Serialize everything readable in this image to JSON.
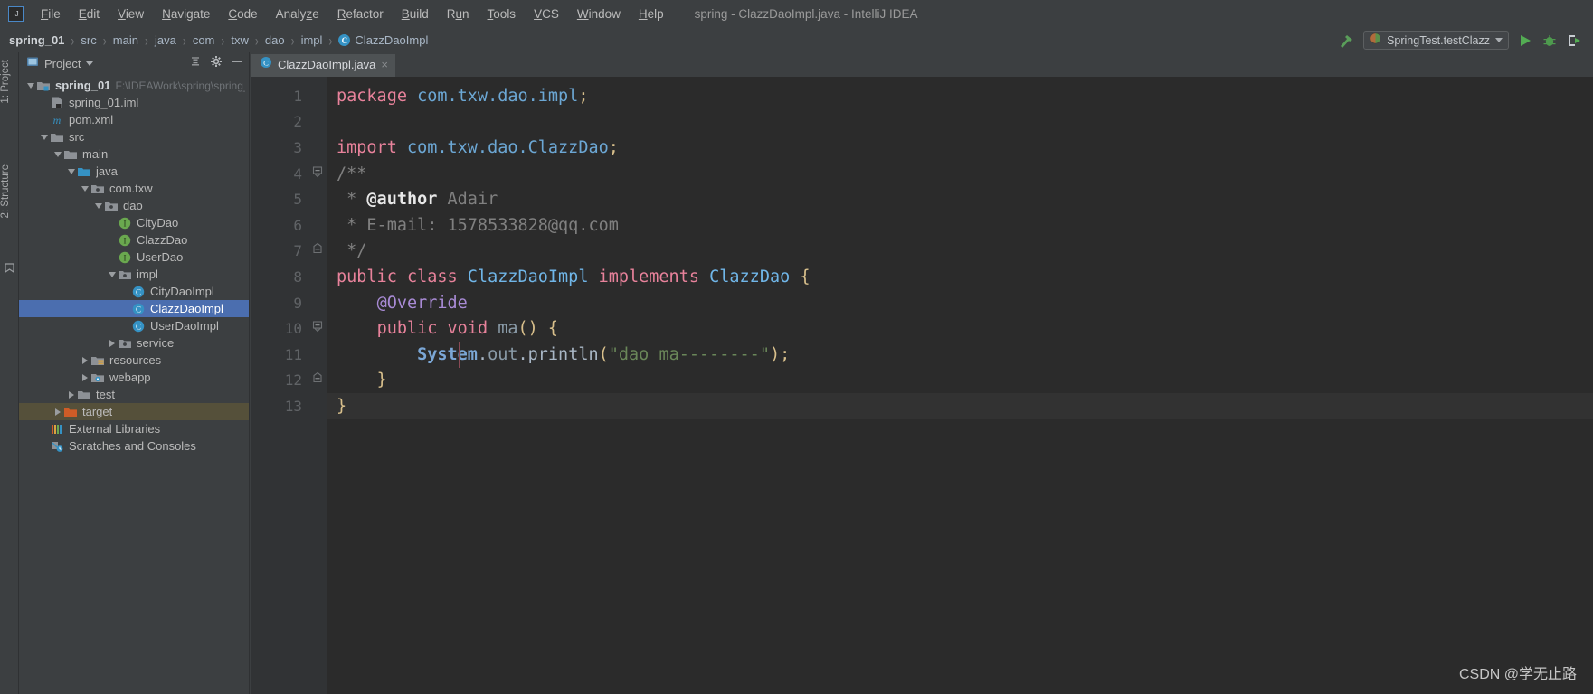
{
  "window": {
    "title": "spring - ClazzDaoImpl.java - IntelliJ IDEA",
    "logo_text": "IJ"
  },
  "menubar": {
    "items": [
      {
        "label": "File",
        "mnemonic": "F"
      },
      {
        "label": "Edit",
        "mnemonic": "E"
      },
      {
        "label": "View",
        "mnemonic": "V"
      },
      {
        "label": "Navigate",
        "mnemonic": "N"
      },
      {
        "label": "Code",
        "mnemonic": "C"
      },
      {
        "label": "Analyze",
        "mnemonic": "z"
      },
      {
        "label": "Refactor",
        "mnemonic": "R"
      },
      {
        "label": "Build",
        "mnemonic": "B"
      },
      {
        "label": "Run",
        "mnemonic": "u"
      },
      {
        "label": "Tools",
        "mnemonic": "T"
      },
      {
        "label": "VCS",
        "mnemonic": "V"
      },
      {
        "label": "Window",
        "mnemonic": "W"
      },
      {
        "label": "Help",
        "mnemonic": "H"
      }
    ]
  },
  "navbar": {
    "crumbs": [
      {
        "label": "spring_01",
        "bold": true,
        "icon": null
      },
      {
        "label": "src",
        "bold": false,
        "icon": null
      },
      {
        "label": "main",
        "bold": false,
        "icon": null
      },
      {
        "label": "java",
        "bold": false,
        "icon": null
      },
      {
        "label": "com",
        "bold": false,
        "icon": null
      },
      {
        "label": "txw",
        "bold": false,
        "icon": null
      },
      {
        "label": "dao",
        "bold": false,
        "icon": null
      },
      {
        "label": "impl",
        "bold": false,
        "icon": null
      },
      {
        "label": "ClazzDaoImpl",
        "bold": false,
        "icon": "class-icon"
      }
    ],
    "separator": "›",
    "run_config": "SpringTest.testClazz",
    "icons": [
      "hammer-icon",
      "run-icon",
      "debug-icon",
      "run-with-coverage-icon"
    ]
  },
  "left_strip": {
    "tabs": [
      {
        "label": "1: Project"
      },
      {
        "label": "2: Structure"
      }
    ],
    "bottom_icon": "favorites-icon"
  },
  "project_panel": {
    "title": "Project",
    "icons": [
      "project-view-icon",
      "collapse-all-icon",
      "settings-gear-icon",
      "hide-icon"
    ],
    "tree": [
      {
        "indent": 0,
        "twisty": "down",
        "icon": "module-icon",
        "label": "spring_01",
        "bold": true,
        "path": "F:\\IDEAWork\\spring\\spring_",
        "state": "normal"
      },
      {
        "indent": 1,
        "twisty": "none",
        "icon": "iml-icon",
        "label": "spring_01.iml",
        "bold": false,
        "path": "",
        "state": "normal"
      },
      {
        "indent": 1,
        "twisty": "none",
        "icon": "maven-icon",
        "label": "pom.xml",
        "bold": false,
        "path": "",
        "state": "normal"
      },
      {
        "indent": 1,
        "twisty": "down",
        "icon": "folder-icon",
        "label": "src",
        "bold": false,
        "path": "",
        "state": "normal"
      },
      {
        "indent": 2,
        "twisty": "down",
        "icon": "folder-icon",
        "label": "main",
        "bold": false,
        "path": "",
        "state": "normal"
      },
      {
        "indent": 3,
        "twisty": "down",
        "icon": "source-root-icon",
        "label": "java",
        "bold": false,
        "path": "",
        "state": "normal"
      },
      {
        "indent": 4,
        "twisty": "down",
        "icon": "package-icon",
        "label": "com.txw",
        "bold": false,
        "path": "",
        "state": "normal"
      },
      {
        "indent": 5,
        "twisty": "down",
        "icon": "package-icon",
        "label": "dao",
        "bold": false,
        "path": "",
        "state": "normal"
      },
      {
        "indent": 6,
        "twisty": "none",
        "icon": "interface-icon",
        "label": "CityDao",
        "bold": false,
        "path": "",
        "state": "normal"
      },
      {
        "indent": 6,
        "twisty": "none",
        "icon": "interface-icon",
        "label": "ClazzDao",
        "bold": false,
        "path": "",
        "state": "normal"
      },
      {
        "indent": 6,
        "twisty": "none",
        "icon": "interface-icon",
        "label": "UserDao",
        "bold": false,
        "path": "",
        "state": "normal"
      },
      {
        "indent": 6,
        "twisty": "down",
        "icon": "package-icon",
        "label": "impl",
        "bold": false,
        "path": "",
        "state": "normal"
      },
      {
        "indent": 7,
        "twisty": "none",
        "icon": "class-icon",
        "label": "CityDaoImpl",
        "bold": false,
        "path": "",
        "state": "normal"
      },
      {
        "indent": 7,
        "twisty": "none",
        "icon": "class-icon",
        "label": "ClazzDaoImpl",
        "bold": false,
        "path": "",
        "state": "selected"
      },
      {
        "indent": 7,
        "twisty": "none",
        "icon": "class-icon",
        "label": "UserDaoImpl",
        "bold": false,
        "path": "",
        "state": "normal"
      },
      {
        "indent": 6,
        "twisty": "right",
        "icon": "package-icon",
        "label": "service",
        "bold": false,
        "path": "",
        "state": "normal"
      },
      {
        "indent": 4,
        "twisty": "right",
        "icon": "resources-root-icon",
        "label": "resources",
        "bold": false,
        "path": "",
        "state": "normal"
      },
      {
        "indent": 4,
        "twisty": "right",
        "icon": "webapp-icon",
        "label": "webapp",
        "bold": false,
        "path": "",
        "state": "normal"
      },
      {
        "indent": 3,
        "twisty": "right",
        "icon": "folder-icon",
        "label": "test",
        "bold": false,
        "path": "",
        "state": "normal"
      },
      {
        "indent": 2,
        "twisty": "right",
        "icon": "excluded-folder-icon",
        "label": "target",
        "bold": false,
        "path": "",
        "state": "marked"
      },
      {
        "indent": 1,
        "twisty": "none",
        "icon": "external-libraries-icon",
        "label": "External Libraries",
        "bold": false,
        "path": "",
        "state": "normal"
      },
      {
        "indent": 1,
        "twisty": "none",
        "icon": "scratches-icon",
        "label": "Scratches and Consoles",
        "bold": false,
        "path": "",
        "state": "normal"
      }
    ]
  },
  "editor": {
    "tab": {
      "label": "ClazzDaoImpl.java",
      "icon": "class-icon",
      "close": "×"
    },
    "caret_line": 13,
    "lines": [
      {
        "n": 1,
        "gutter": [],
        "fold": "",
        "tokens": [
          {
            "t": "package ",
            "c": "kw2"
          },
          {
            "t": "com.txw.dao.impl",
            "c": "ident"
          },
          {
            "t": ";",
            "c": "semi"
          }
        ]
      },
      {
        "n": 2,
        "gutter": [],
        "fold": "",
        "tokens": []
      },
      {
        "n": 3,
        "gutter": [],
        "fold": "",
        "tokens": [
          {
            "t": "import ",
            "c": "kw2"
          },
          {
            "t": "com.txw.dao.ClazzDao",
            "c": "ident"
          },
          {
            "t": ";",
            "c": "semi"
          }
        ]
      },
      {
        "n": 4,
        "gutter": [
          "javadoc-icon"
        ],
        "fold": "collapse-top",
        "tokens": [
          {
            "t": "/**",
            "c": "cmt"
          }
        ]
      },
      {
        "n": 5,
        "gutter": [],
        "fold": "",
        "tokens": [
          {
            "t": " * ",
            "c": "cmt"
          },
          {
            "t": "@author",
            "c": "cmt-tag"
          },
          {
            "t": " Adair",
            "c": "cmt"
          }
        ]
      },
      {
        "n": 6,
        "gutter": [],
        "fold": "",
        "tokens": [
          {
            "t": " * E-mail: 1578533828@qq.com",
            "c": "cmt"
          }
        ]
      },
      {
        "n": 7,
        "gutter": [],
        "fold": "collapse-bottom",
        "tokens": [
          {
            "t": " */",
            "c": "cmt"
          }
        ]
      },
      {
        "n": 8,
        "gutter": [
          "spring-bean-icon"
        ],
        "fold": "",
        "tokens": [
          {
            "t": "public class ",
            "c": "kw2"
          },
          {
            "t": "ClazzDaoImpl ",
            "c": "cls-name"
          },
          {
            "t": "implements ",
            "c": "kw2"
          },
          {
            "t": "ClazzDao ",
            "c": "cls-name"
          },
          {
            "t": "{",
            "c": "brace"
          }
        ]
      },
      {
        "n": 9,
        "gutter": [],
        "fold": "",
        "tokens": [
          {
            "t": "    ",
            "c": "plain"
          },
          {
            "t": "@Override",
            "c": "anno"
          }
        ]
      },
      {
        "n": 10,
        "gutter": [
          "implementing-method-icon",
          "overriding-arrow-icon"
        ],
        "fold": "collapse-top",
        "tokens": [
          {
            "t": "    ",
            "c": "plain"
          },
          {
            "t": "public void ",
            "c": "kw2"
          },
          {
            "t": "ma",
            "c": "method"
          },
          {
            "t": "() ",
            "c": "brace"
          },
          {
            "t": "{",
            "c": "brace"
          }
        ]
      },
      {
        "n": 11,
        "gutter": [],
        "fold": "",
        "tokens": [
          {
            "t": "        ",
            "c": "plain"
          },
          {
            "t": "System",
            "c": "sysname"
          },
          {
            "t": ".",
            "c": "plain"
          },
          {
            "t": "out",
            "c": "method"
          },
          {
            "t": ".",
            "c": "plain"
          },
          {
            "t": "println",
            "c": "plain"
          },
          {
            "t": "(",
            "c": "brace"
          },
          {
            "t": "\"dao ma--------\"",
            "c": "str"
          },
          {
            "t": ")",
            "c": "brace"
          },
          {
            "t": ";",
            "c": "semi"
          }
        ]
      },
      {
        "n": 12,
        "gutter": [],
        "fold": "collapse-bottom",
        "tokens": [
          {
            "t": "    ",
            "c": "plain"
          },
          {
            "t": "}",
            "c": "brace"
          }
        ]
      },
      {
        "n": 13,
        "gutter": [],
        "fold": "",
        "tokens": [
          {
            "t": "}",
            "c": "brace"
          }
        ]
      }
    ]
  },
  "watermark": {
    "text": "CSDN @学无止路"
  },
  "colors": {
    "panel_bg": "#3c3f41",
    "editor_bg": "#2b2b2b",
    "gutter_bg": "#313335",
    "selection_blue": "#4b6eaf",
    "keyword_pink": "#e8829b",
    "string_green": "#6a8759",
    "identifier_blue": "#6ca7d4",
    "annotation_purple": "#a98bd6",
    "comment_gray": "#808080"
  }
}
